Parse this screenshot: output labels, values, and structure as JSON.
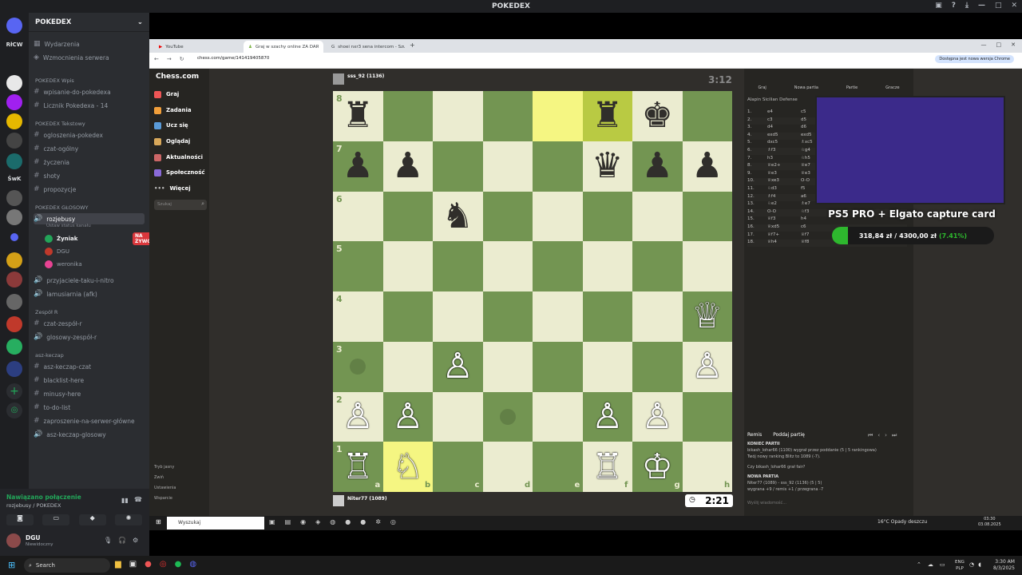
{
  "app": {
    "title": "POKEDEX"
  },
  "discord": {
    "guild_name": "POKEDEX",
    "server_labels": [
      "RłCW",
      "ŚwK"
    ],
    "top_items": [
      "Wydarzenia",
      "Wzmocnienia serwera"
    ],
    "categories": {
      "wpis": "POKEDEX Wpis",
      "tekstowy": "POKEDEX Tekstowy",
      "glosowy": "POKEDEX GŁOSOWY",
      "zespol": "Zespół R",
      "asz": "asz-keczap"
    },
    "wpis_channels": [
      "wpisanie-do-pokedexa",
      "Licznik Pokedexa - 14"
    ],
    "text_channels": [
      "ogloszenia-pokedex",
      "czat-ogólny",
      "życzenia",
      "shoty",
      "propozycje"
    ],
    "voice_channel": "rozjebusy",
    "voice_status": "Ustaw status kanału",
    "voice_users": [
      "Żyniak",
      "DGU",
      "weronika"
    ],
    "live_badge": "NA ŻYWO",
    "voice_more": [
      "przyjaciele-taku-i-nitro",
      "lamusiarnia (afk)"
    ],
    "zespol_channels": [
      "czat-zespół-r",
      "glosowy-zespół-r"
    ],
    "asz_channels": [
      "asz-keczap-czat",
      "blacklist-here",
      "minusy-here",
      "to-do-list",
      "zaproszenie-na-serwer-główne",
      "asz-keczap-glosowy"
    ],
    "connection_status": "Nawiązano połączenie",
    "connection_channel": "rozjebusy / POKEDEX",
    "user": {
      "name": "DGU",
      "status": "Niewidoczny"
    }
  },
  "browser": {
    "tabs": [
      "YouTube",
      "Graj w szachy online ZA DARMO",
      "shoei nxr3 sena intercom - Szu"
    ],
    "url": "chess.com/game/141419405870",
    "update_notice": "Dostępna jest nowa wersja Chrome"
  },
  "chess": {
    "logo": "Chess.com",
    "nav": [
      "Graj",
      "Zadania",
      "Ucz się",
      "Oglądaj",
      "Aktualności",
      "Społeczność",
      "Więcej"
    ],
    "search_placeholder": "Szukaj",
    "bottom_nav": [
      "Tryb jasny",
      "Zwiń",
      "Ustawienia",
      "Wsparcie"
    ],
    "top_player": "sss_92 (1136)",
    "top_clock": "3:12",
    "bottom_player": "Niter77 (1089)",
    "bottom_clock": "2:21",
    "ranks": [
      "8",
      "7",
      "6",
      "5",
      "4",
      "3",
      "2",
      "1"
    ],
    "files": [
      "a",
      "b",
      "c",
      "d",
      "e",
      "f",
      "g",
      "h"
    ],
    "panel_tabs": [
      "Graj",
      "Nowa partia",
      "Partie",
      "Gracze"
    ],
    "opening": "Alapin Sicilian Defense",
    "moves": [
      [
        "1.",
        "e4",
        "c5"
      ],
      [
        "2.",
        "c3",
        "d5"
      ],
      [
        "3.",
        "d4",
        "d6"
      ],
      [
        "4.",
        "exd5",
        "exd5"
      ],
      [
        "5.",
        "dxc5",
        "♗xc5"
      ],
      [
        "6.",
        "♗f3",
        "♘g4"
      ],
      [
        "7.",
        "h3",
        "♘h5"
      ],
      [
        "8.",
        "♕e2+",
        "♕e7"
      ],
      [
        "9.",
        "♕e3",
        "♕e3"
      ],
      [
        "10.",
        "♕xe3",
        "O-O"
      ],
      [
        "11.",
        "♘d3",
        "f5"
      ],
      [
        "12.",
        "♗f4",
        "a6"
      ],
      [
        "13.",
        "♘e2",
        "♗e7"
      ],
      [
        "14.",
        "O-O",
        "♘f3"
      ],
      [
        "15.",
        "♕f3",
        "h4"
      ],
      [
        "16.",
        "♕xd5",
        "c6"
      ],
      [
        "17.",
        "♕f7+",
        "♕f7"
      ],
      [
        "18.",
        "♕h4",
        "♕f8"
      ]
    ],
    "remis": "Remis",
    "resign": "Poddaj partię",
    "chat": [
      "KONIEC PARTII",
      "bikash_lohar66 (1100) wygrał przez poddanie (5 | 5 rankingowa)",
      "Twój nowy ranking Blitz to 1089 (-7).",
      "Czy bikash_lohar66 grał fair?",
      "NOWA PARTIA",
      "Niter77 (1089) - sss_92 (1136) (5 | 5)",
      "wygrana +9 / remis +1 / przegrana -7"
    ],
    "chat_placeholder": "Wyślij wiadomość..."
  },
  "overlay": {
    "title": "PS5 PRO + Elgato capture card",
    "raised": "318,84 zł",
    "goal": "4300,00 zł",
    "percent": "(7.41%)",
    "progress": 0.0741
  },
  "win_taskbar": {
    "search": "Wyszukaj",
    "weather": "16°C  Opady deszczu",
    "time": "03:30",
    "date": "03.08.2025"
  },
  "host_taskbar": {
    "search": "Search",
    "lang": "ENG",
    "region": "PLP",
    "time": "3:30 AM",
    "date": "8/3/2025"
  },
  "colors": {
    "accent": "#5865f2",
    "live": "#da373c",
    "board_light": "#ebecd0",
    "board_dark": "#739552",
    "highlight": "#f5f682",
    "progress": "#2eb82e"
  }
}
